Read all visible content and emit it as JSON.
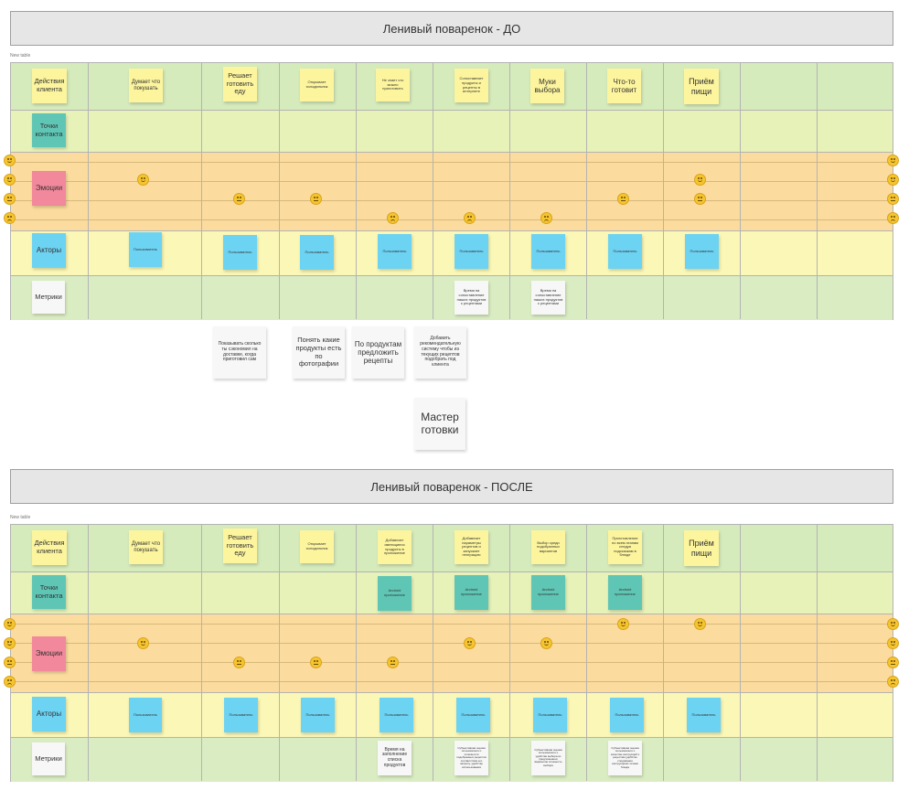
{
  "before": {
    "title": "Ленивый поваренок - ДО",
    "table_label": "New table",
    "lanes": {
      "actions": "Действия клиента",
      "touch": "Точки контакта",
      "emotions": "Эмоции",
      "actors": "Акторы",
      "metrics": "Метрики"
    },
    "steps": [
      "Думает что покушать",
      "Решает готовить еду",
      "Открывает холодильник",
      "Не знает что можно приготовить",
      "Сопоставляет продукты и рецепты в интернете",
      "Муки выбора",
      "Что-то готовит",
      "Приём пищи"
    ],
    "actor": "Пользователь",
    "metrics": [
      "Время на сопоставление наших продуктов с рецептами",
      "Время на сопоставление наших продуктов с рецептами"
    ],
    "ideas": [
      "Показывать сколько ты сэкономил на доставке, когда приготовил сам",
      "Понять какие продукты есть по фотографии",
      "По продуктам предложить рецепты",
      "Добавить рекомендательную систему чтобы из текущих рецептов подобрать под клиента",
      "Мастер готовки"
    ]
  },
  "after": {
    "title": "Ленивый поваренок - ПОСЛЕ",
    "table_label": "New table",
    "lanes": {
      "actions": "Действия клиента",
      "touch": "Точки контакта",
      "emotions": "Эмоции",
      "actors": "Акторы",
      "metrics": "Метрики"
    },
    "steps": [
      "Думает что покушать",
      "Решает готовить еду",
      "Открывает холодильник",
      "Добавляет имеющиеся продукты в приложение",
      "Добавляет параметры рецептов и запускает генерацию",
      "Выбор среди подобранных вариантов",
      "Приготовление по всем этапам следуя подсказкам в блюде",
      "Приём пищи"
    ],
    "touchpoint": "Android приложение",
    "actor": "Пользователь",
    "metrics": [
      "Время на заполнение списка продуктов",
      "Субъективная оценка пользователя о полезности подобранных рецептов соответствия его запросу, удобству использования",
      "Субъективная оценка пользователя о удобстве выбора из предложенных вариантов сложность выбора",
      "Субъективная оценка пользователя о качестве инструкций к рецептам удобство следования инструкциям готовки блюда"
    ]
  }
}
